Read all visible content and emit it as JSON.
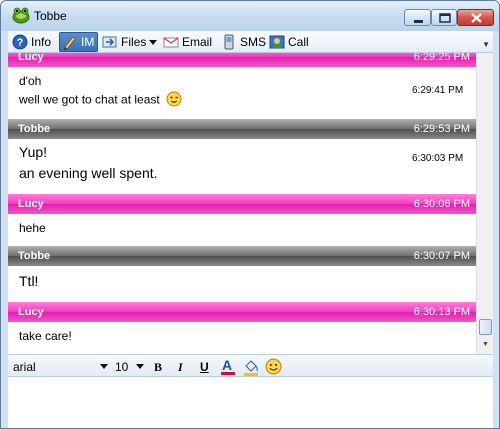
{
  "window": {
    "title": "Tobbe"
  },
  "toolbar": {
    "items": [
      {
        "label": "Info",
        "icon": "info-icon"
      },
      {
        "label": "IM",
        "icon": "pencil-icon",
        "active": true
      },
      {
        "label": "Files",
        "icon": "files-icon",
        "dropdown": true
      },
      {
        "label": "Email",
        "icon": "email-icon"
      },
      {
        "label": "SMS",
        "icon": "phone-icon"
      },
      {
        "label": "Call",
        "icon": "call-icon"
      }
    ]
  },
  "chat": {
    "messages": [
      {
        "sender": "Lucy",
        "header_time": "6:29:25 PM",
        "lines": [
          {
            "text": "d'oh",
            "time": ""
          },
          {
            "text": "well we got to chat at least",
            "time": "6:29:41 PM",
            "emoticon": "smiley-wink-icon"
          }
        ]
      },
      {
        "sender": "Tobbe",
        "header_time": "6:29:53 PM",
        "lines": [
          {
            "text": "Yup!",
            "time": "6:30:03 PM"
          },
          {
            "text": "an evening well spent.",
            "time": ""
          }
        ]
      },
      {
        "sender": "Lucy",
        "header_time": "6:30:06 PM",
        "lines": [
          {
            "text": "hehe",
            "time": ""
          }
        ]
      },
      {
        "sender": "Tobbe",
        "header_time": "6:30:07 PM",
        "lines": [
          {
            "text": "Ttl!",
            "time": ""
          }
        ]
      },
      {
        "sender": "Lucy",
        "header_time": "6:30:13 PM",
        "lines": [
          {
            "text": "take care!",
            "time": ""
          }
        ]
      }
    ]
  },
  "format": {
    "font": "arial",
    "size": "10",
    "bold": "B",
    "italic": "I",
    "underline": "U",
    "color_letter": "A"
  },
  "colors": {
    "lucy_header": "#f23ac2",
    "tobbe_header": "#6f6f6f",
    "active_tab": "#3a6fb8"
  }
}
